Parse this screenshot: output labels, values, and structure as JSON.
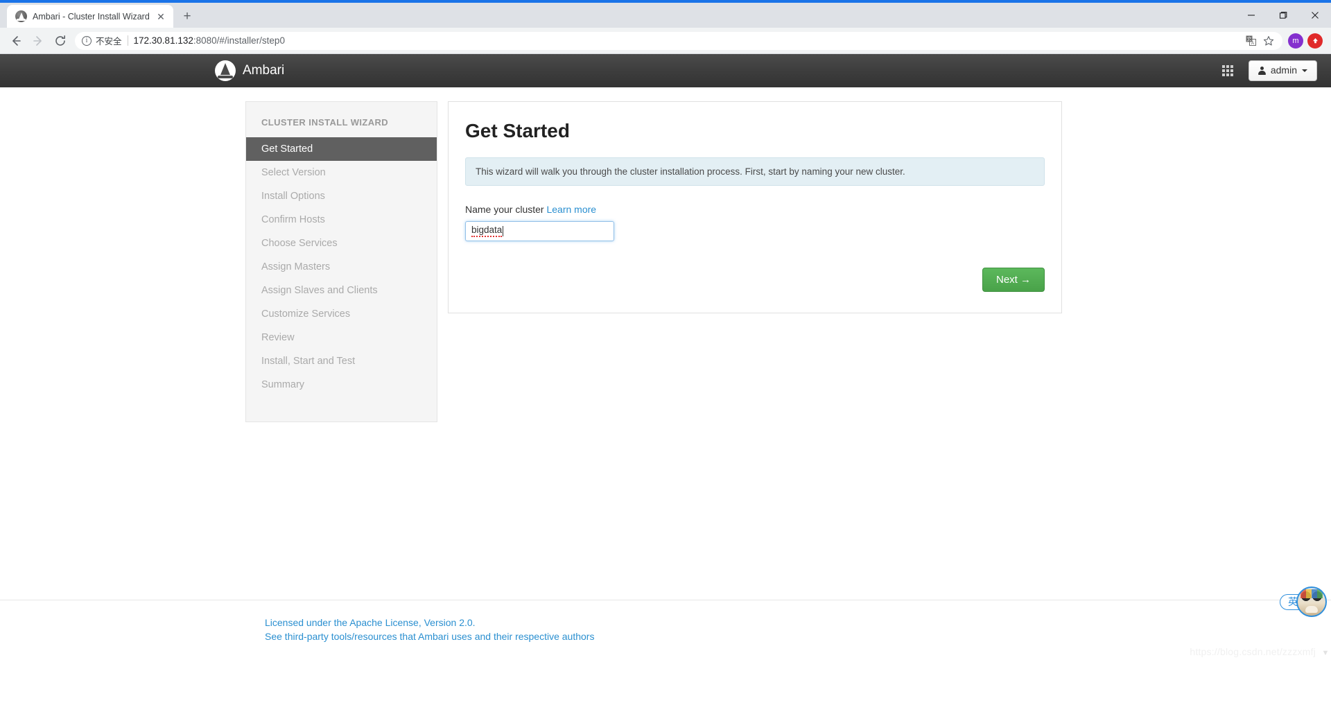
{
  "browser": {
    "tab": {
      "title": "Ambari - Cluster Install Wizard",
      "favicon": "ambari-favicon",
      "close_label": "✕"
    },
    "new_tab_label": "+",
    "window_controls": {
      "minimize": "minimize-icon",
      "maximize": "maximize-icon",
      "close": "close-icon"
    },
    "nav": {
      "back": "back-arrow-icon",
      "forward": "forward-arrow-icon",
      "reload": "reload-icon"
    },
    "omnibox": {
      "security_label": "不安全",
      "url_host": "172.30.81.132",
      "url_path": ":8080/#/installer/step0",
      "full_url": "172.30.81.132:8080/#/installer/step0",
      "translate_icon": "translate-icon",
      "bookmark_icon": "star-icon"
    },
    "profile_initial": "m",
    "extension_icon": "arrow-up-extension-icon"
  },
  "app_header": {
    "logo": "ambari-logo",
    "brand": "Ambari",
    "grid_icon": "apps-grid-icon",
    "user_menu": {
      "label": "admin",
      "user_icon": "user-icon",
      "caret": "chevron-down-icon"
    }
  },
  "sidebar": {
    "title": "CLUSTER INSTALL WIZARD",
    "steps": [
      {
        "label": "Get Started",
        "active": true
      },
      {
        "label": "Select Version",
        "active": false
      },
      {
        "label": "Install Options",
        "active": false
      },
      {
        "label": "Confirm Hosts",
        "active": false
      },
      {
        "label": "Choose Services",
        "active": false
      },
      {
        "label": "Assign Masters",
        "active": false
      },
      {
        "label": "Assign Slaves and Clients",
        "active": false
      },
      {
        "label": "Customize Services",
        "active": false
      },
      {
        "label": "Review",
        "active": false
      },
      {
        "label": "Install, Start and Test",
        "active": false
      },
      {
        "label": "Summary",
        "active": false
      }
    ]
  },
  "main": {
    "title": "Get Started",
    "info_text": "This wizard will walk you through the cluster installation process. First, start by naming your new cluster.",
    "field_label": "Name your cluster",
    "learn_more_label": "Learn more",
    "cluster_name_value": "bigdata",
    "cluster_name_placeholder": "",
    "next_label": "Next →"
  },
  "footer": {
    "license_link": "Licensed under the Apache License, Version 2.0.",
    "third_party_link": "See third-party tools/resources that Ambari uses and their respective authors"
  },
  "overlays": {
    "ime_mode": "英",
    "ime_avatar": "cat-avatar-icon",
    "watermark": "https://blog.csdn.net/zzzxmfj"
  },
  "colors": {
    "accent_blue": "#2a8fd0",
    "next_green": "#5cb85c",
    "header_dark": "#3c3c3c",
    "active_step": "#606060",
    "info_bg": "#e3eff4",
    "browser_blue": "#1a73e8"
  }
}
